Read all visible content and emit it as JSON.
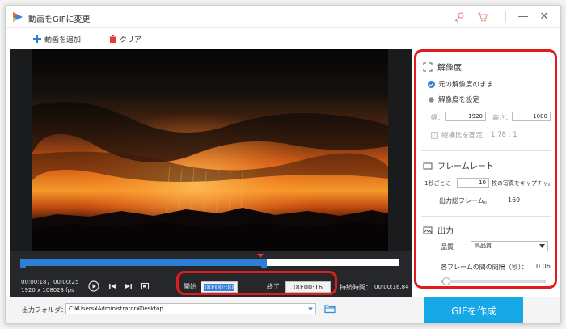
{
  "window": {
    "title": "動画をGIFに変更"
  },
  "toolbar": {
    "add_video": "動画を追加",
    "clear": "クリア"
  },
  "player": {
    "time_current": "00:00:18",
    "time_separator": "/",
    "time_total": "00:00:25",
    "resolution": "1920 x 1080",
    "fps": "23 fps",
    "timeline_selection_fraction": 0.64
  },
  "trim": {
    "start_label": "開始",
    "start_value": "00:00:00",
    "end_label": "終了",
    "end_value": "00:00:16",
    "duration_label": "持続時間：",
    "duration_value": "00:00:16.84"
  },
  "settings": {
    "resolution": {
      "title": "解像度",
      "keep_original": "元の解像度のまま",
      "set_resolution": "解像度を設定",
      "width_label": "幅：",
      "width_value": "1920",
      "height_label": "高さ：",
      "height_value": "1080",
      "lock_ratio": "縦横比を固定",
      "ratio_value": "1.78 : 1"
    },
    "frame_rate": {
      "title": "フレームレート",
      "per_second_prefix": "1秒ごとに",
      "per_second_value": "10",
      "per_second_suffix": "枚の写真をキャプチャ。",
      "total_frames_label": "出力総フレーム。",
      "total_frames_value": "169"
    },
    "output": {
      "title": "出力",
      "quality_label": "品質",
      "quality_value": "高品質",
      "interval_label": "各フレームの間の間隔（秒）：",
      "interval_value": "0.06",
      "interval_slider_fraction": 0.05
    }
  },
  "bottom": {
    "output_folder_label": "出力フォルダ：",
    "output_folder_path": "C:¥Users¥Administrator¥Desktop",
    "create_button": "GIFを作成"
  },
  "colors": {
    "accent_blue": "#16a8e6",
    "highlight_red": "#e01d1d",
    "timeline_blue": "#2b7fd6"
  }
}
